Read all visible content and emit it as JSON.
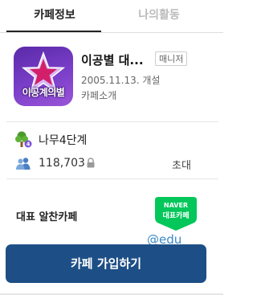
{
  "tabs": [
    {
      "label": "카페정보",
      "active": true
    },
    {
      "label": "나의활동",
      "active": false
    }
  ],
  "cafe": {
    "logo_text": "이공계의별",
    "name": "이공별 대...",
    "role_badge": "매니저",
    "founded": "2005.11.13. 개설",
    "intro_link": "카페소개"
  },
  "stats": {
    "grade_icon": "tree-icon",
    "grade": "나무4단계",
    "grade_level": "4",
    "members_icon": "members-icon",
    "member_count": "118,703",
    "invite_label": "초대"
  },
  "featured": {
    "label": "대표 알찬카페",
    "badge_line1": "NAVER",
    "badge_line2": "대표카페",
    "badge_color": "#03c75a"
  },
  "watermark": "@edu",
  "join_button": {
    "label": "카페 가입하기",
    "color": "#1d4f86"
  }
}
